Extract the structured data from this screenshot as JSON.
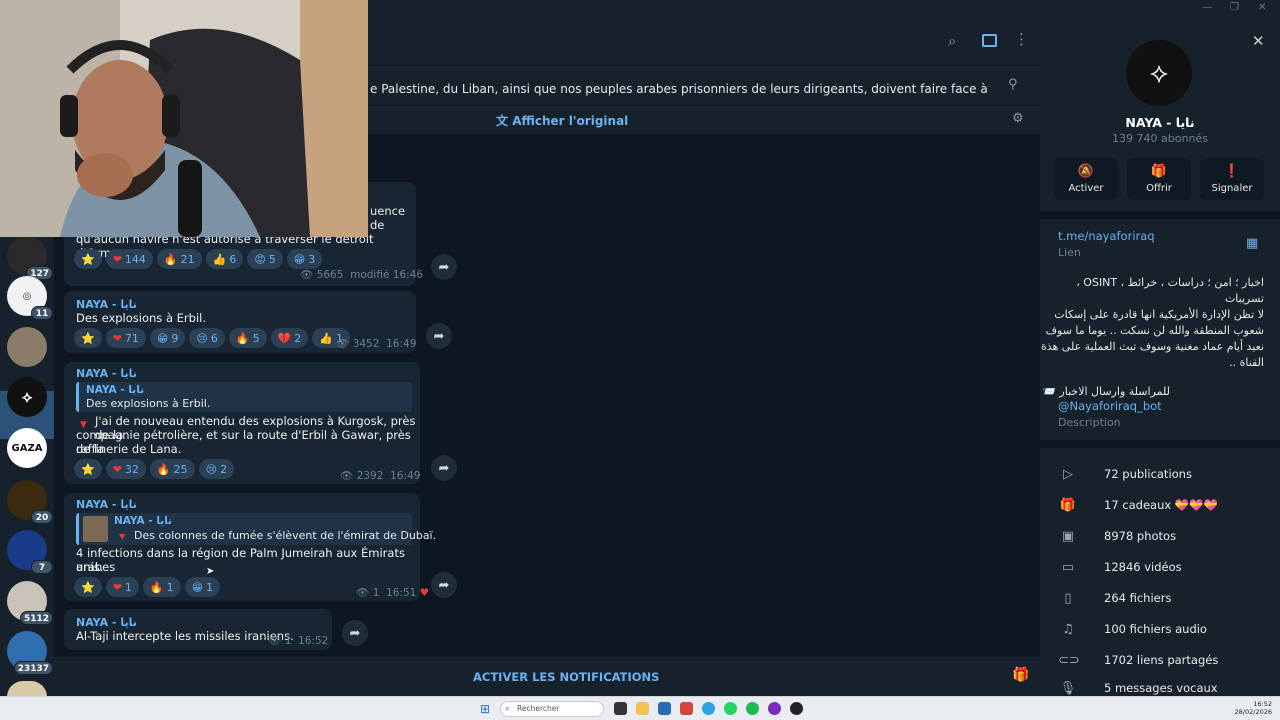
{
  "pinned": {
    "text": "e Palestine, du Liban, ainsi que nos peuples arabes prisonniers de leurs dirigeants, doivent faire face à l'Amérique et à l'entité s..."
  },
  "translate": {
    "label": "Afficher l'original"
  },
  "strip": {
    "badges": [
      "127",
      "11",
      "20",
      "7",
      "5112",
      "23137"
    ],
    "gaza_label": "GAZA"
  },
  "messages": [
    {
      "text_partial_right": "uence de",
      "text": "qu'aucun navire n'est autorisé à traverser le détroit d'Ormuz.",
      "reactions": [
        {
          "icon": "⭐",
          "count": ""
        },
        {
          "icon": "❤",
          "count": "144"
        },
        {
          "icon": "🔥",
          "count": "21"
        },
        {
          "icon": "👍",
          "count": "6"
        },
        {
          "icon": "😡",
          "count": "5"
        },
        {
          "icon": "😁",
          "count": "3"
        }
      ],
      "views": "5665",
      "edited": "modifié",
      "time": "16:46"
    },
    {
      "sender": "NAYA - نايا",
      "text": "Des explosions à Erbil.",
      "reactions": [
        {
          "icon": "⭐",
          "count": ""
        },
        {
          "icon": "❤",
          "count": "71"
        },
        {
          "icon": "😁",
          "count": "9"
        },
        {
          "icon": "😢",
          "count": "6"
        },
        {
          "icon": "🔥",
          "count": "5"
        },
        {
          "icon": "💔",
          "count": "2"
        },
        {
          "icon": "👍",
          "count": "1"
        }
      ],
      "views": "3452",
      "time": "16:49"
    },
    {
      "sender": "NAYA - نايا",
      "quote_sender": "NAYA - نايا",
      "quote_text": "Des explosions à Erbil.",
      "text_lines": [
        "J'ai de nouveau entendu des explosions à Kurgosk, près de la",
        "compagnie pétrolière, et sur la route d'Erbil à Gawar, près de la",
        "raffinerie de Lana."
      ],
      "reactions": [
        {
          "icon": "⭐",
          "count": ""
        },
        {
          "icon": "❤",
          "count": "32"
        },
        {
          "icon": "🔥",
          "count": "25"
        },
        {
          "icon": "😢",
          "count": "2"
        }
      ],
      "views": "2392",
      "time": "16:49"
    },
    {
      "sender": "NAYA - نايا",
      "quote_sender": "NAYA - نايا",
      "quote_text": "Des colonnes de fumée s'élèvent de l'émirat de Dubaï.",
      "text_lines": [
        "4 infections dans la région de Palm Jumeirah aux Émirats arabes",
        "unis."
      ],
      "reactions": [
        {
          "icon": "⭐",
          "count": ""
        },
        {
          "icon": "❤",
          "count": "1"
        },
        {
          "icon": "🔥",
          "count": "1"
        },
        {
          "icon": "😁",
          "count": "1"
        }
      ],
      "views": "1",
      "time": "16:51"
    },
    {
      "sender": "NAYA - نايا",
      "text": "Al-Taji intercepte les missiles iraniens.",
      "views": "1",
      "time": "16:52"
    }
  ],
  "bottom": {
    "notify_label": "ACTIVER LES NOTIFICATIONS"
  },
  "panel": {
    "name": "NAYA - نايا",
    "subscribers": "139 740 abonnés",
    "buttons": [
      {
        "icon": "bell-off",
        "label": "Activer"
      },
      {
        "icon": "gift",
        "label": "Offrir"
      },
      {
        "icon": "alert",
        "label": "Signaler"
      }
    ],
    "link": "t.me/nayaforiraq",
    "link_label": "Lien",
    "desc_lines": [
      "اخبار ؛ امن ؛ دراسات ، خرائط ، OSINT ، تسريبات",
      "",
      "لا تظن الإدارة الأمريكية انها قادرة على إسكات",
      "شعوب المنطقة والله لن نسكت .. يوما ما سوف",
      "نعيد أيام عماد مغنية وسوف تبث العملية على هذة",
      "القناة ..",
      "",
      "للمراسلة وارسال الاخبار 📨"
    ],
    "bot_handle": "@Nayaforiraq_bot",
    "desc_label": "Description",
    "stats": [
      {
        "icon": "publications-icon",
        "label": "72 publications"
      },
      {
        "icon": "gift-icon",
        "label": "17 cadeaux 💝💝💝"
      },
      {
        "icon": "photo-icon",
        "label": "8978 photos"
      },
      {
        "icon": "video-icon",
        "label": "12846 vidéos"
      },
      {
        "icon": "file-icon",
        "label": "264 fichiers"
      },
      {
        "icon": "headphones-icon",
        "label": "100 fichiers audio"
      },
      {
        "icon": "link-icon",
        "label": "1702 liens partagés"
      },
      {
        "icon": "mic-icon",
        "label": "5 messages vocaux"
      }
    ]
  },
  "taskbar": {
    "search_placeholder": "Rechercher",
    "time": "16:52",
    "date": "28/02/2026"
  }
}
